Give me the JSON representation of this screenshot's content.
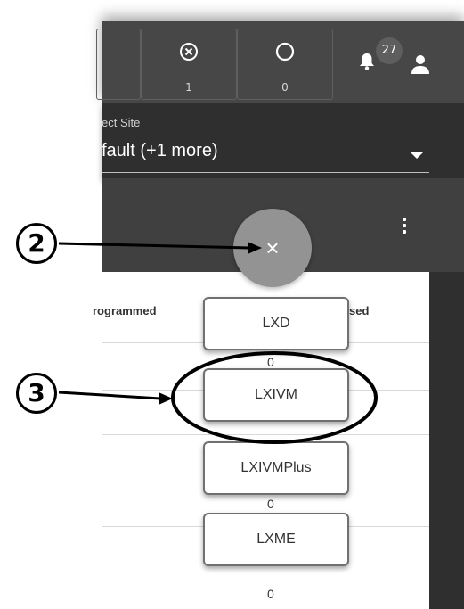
{
  "header": {
    "error_count": "1",
    "idle_count": "0",
    "notification_count": "27",
    "icons": [
      "circle-x-icon",
      "circle-icon",
      "bell-icon",
      "user-icon"
    ]
  },
  "site_selector": {
    "label": "ect Site",
    "value": "fault (+1 more)"
  },
  "table": {
    "headers": [
      "rogrammed",
      "sed"
    ],
    "column_values": [
      "0",
      "0",
      "0",
      "0"
    ]
  },
  "fab_menu": {
    "close_symbol": "×",
    "options": [
      "LXD",
      "LXIVM",
      "LXIVMPlus",
      "LXME"
    ]
  },
  "annotations": {
    "callouts": [
      "2",
      "3"
    ]
  },
  "colors": {
    "header_bg": "#474747",
    "site_bar_bg": "#2f2f2f",
    "fab_bg": "#939393",
    "option_border": "#707070"
  }
}
